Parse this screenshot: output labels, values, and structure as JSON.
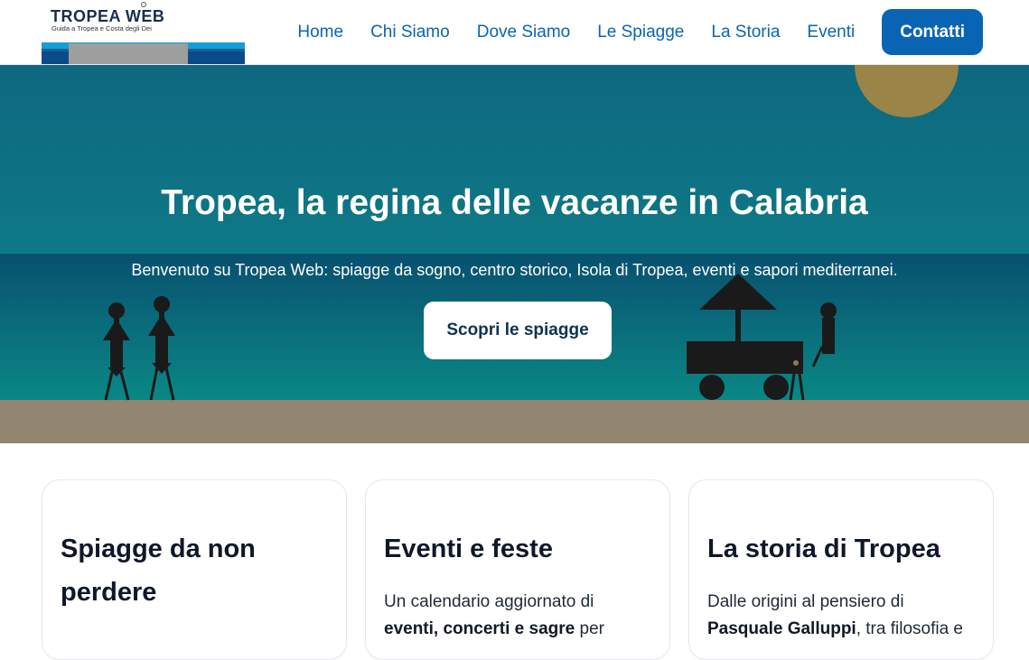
{
  "brand": {
    "title": "TROPEA WEB",
    "subtitle": "Guida a Tropea e Costa degli Dei"
  },
  "nav": {
    "items": [
      "Home",
      "Chi Siamo",
      "Dove Siamo",
      "Le Spiagge",
      "La Storia",
      "Eventi"
    ],
    "cta": "Contatti"
  },
  "hero": {
    "title": "Tropea, la regina delle vacanze in Calabria",
    "subtitle": "Benvenuto su Tropea Web: spiagge da sogno, centro storico, Isola di Tropea, eventi e sapori mediterranei.",
    "button": "Scopri le spiagge"
  },
  "cards": [
    {
      "title": "Spiagge da non perdere"
    },
    {
      "title": "Eventi e feste",
      "text_1": "Un calendario aggiornato di",
      "text_2_bold": "eventi, concerti e sagre",
      "text_2_rest": " per"
    },
    {
      "title": "La storia di Tropea",
      "text_1": "Dalle origini al pensiero di",
      "text_2_bold": "Pasquale Galluppi",
      "text_2_rest": ", tra filosofia e"
    }
  ],
  "colors": {
    "brand_blue": "#0a64b4",
    "sky_top": "#0e6880",
    "sea": "#08506f",
    "sand": "#928571",
    "sun": "#9a8447"
  }
}
